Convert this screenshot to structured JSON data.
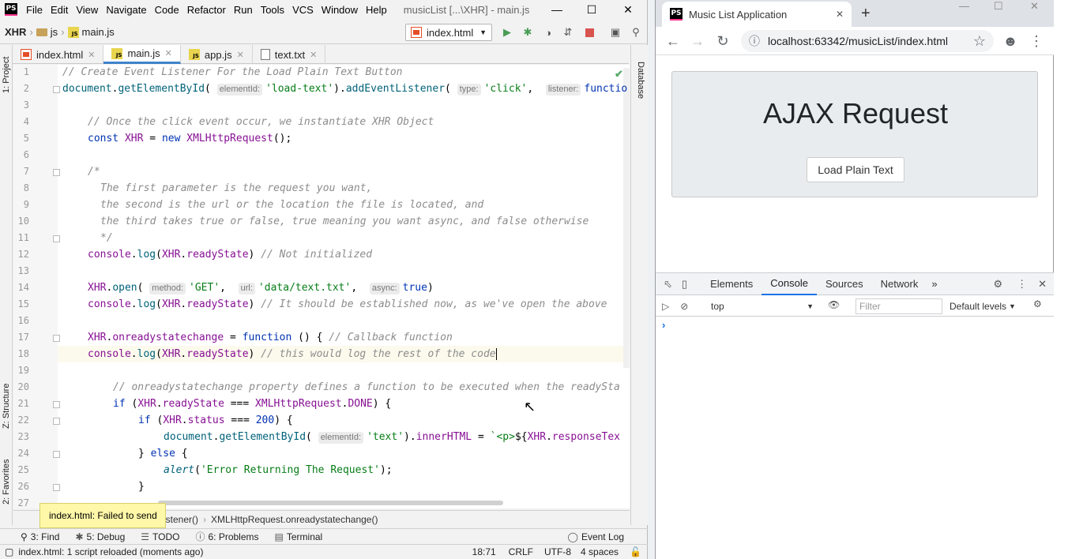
{
  "ide": {
    "logo": "PS",
    "menu": [
      "File",
      "Edit",
      "View",
      "Navigate",
      "Code",
      "Refactor",
      "Run",
      "Tools",
      "VCS",
      "Window",
      "Help"
    ],
    "title": "musicList [...\\XHR] - main.js",
    "breadcrumbs": [
      "XHR",
      "js",
      "main.js"
    ],
    "run_config": "index.html",
    "tabs": [
      {
        "label": "index.html",
        "type": "html"
      },
      {
        "label": "main.js",
        "type": "js"
      },
      {
        "label": "app.js",
        "type": "js"
      },
      {
        "label": "text.txt",
        "type": "txt"
      }
    ],
    "left_tools": [
      "1: Project",
      "Z: Structure",
      "2: Favorites"
    ],
    "right_tools": [
      "Database"
    ],
    "line_numbers": [
      "1",
      "2",
      "3",
      "4",
      "5",
      "6",
      "7",
      "8",
      "9",
      "10",
      "11",
      "12",
      "13",
      "14",
      "15",
      "16",
      "17",
      "18",
      "19",
      "20",
      "21",
      "22",
      "23",
      "24",
      "25",
      "26",
      "27"
    ],
    "breadcrumb_bar": [
      "istener()",
      "XMLHttpRequest.onreadystatechange()"
    ],
    "tooltip": "index.html: Failed to send",
    "tool_windows": {
      "find": "3: Find",
      "debug": "5: Debug",
      "todo": "TODO",
      "problems": "6: Problems",
      "terminal": "Terminal",
      "event_log": "Event Log"
    },
    "status": {
      "message": "index.html: 1 script reloaded (moments ago)",
      "position": "18:71",
      "line_sep": "CRLF",
      "encoding": "UTF-8",
      "indent": "4 spaces"
    }
  },
  "browser": {
    "tab_title": "Music List Application",
    "url": "localhost:63342/musicList/index.html",
    "heading": "AJAX Request",
    "button": "Load Plain Text",
    "devtools": {
      "tabs": [
        "Elements",
        "Console",
        "Sources",
        "Network"
      ],
      "active_tab": "Console",
      "context": "top",
      "filter_placeholder": "Filter",
      "levels": "Default levels"
    }
  }
}
